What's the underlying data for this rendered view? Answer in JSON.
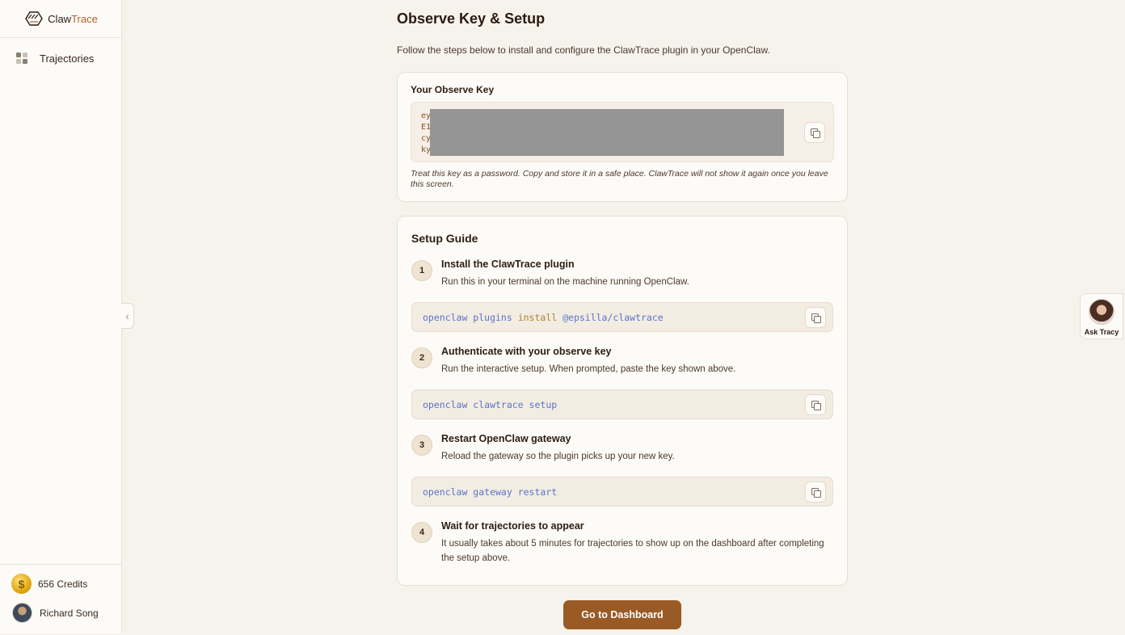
{
  "app": {
    "logo_text_1": "Claw",
    "logo_text_2": "Trace"
  },
  "sidebar": {
    "items": [
      {
        "label": "Trajectories",
        "icon": "grid-icon"
      }
    ],
    "credits_label": "656 Credits",
    "coin_symbol": "$",
    "user_name": "Richard Song",
    "collapse_glyph": "‹"
  },
  "page": {
    "title": "Observe Key & Setup",
    "subtitle": "Follow the steps below to install and configure the ClawTrace plugin in your OpenClaw."
  },
  "key_card": {
    "title": "Your Observe Key",
    "key_text": "ey                                                        tb\nE1                                                        DD\ncy                                                        GR\nky",
    "key_redacted": true,
    "warning": "Treat this key as a password. Copy and store it in a safe place. ClawTrace will not show it again once you leave this screen."
  },
  "guide": {
    "title": "Setup Guide",
    "steps": [
      {
        "num": "1",
        "title": "Install the ClawTrace plugin",
        "desc": "Run this in your terminal on the machine running OpenClaw.",
        "code_pre": "openclaw plugins ",
        "code_kw": "install",
        "code_post": " @epsilla/clawtrace"
      },
      {
        "num": "2",
        "title": "Authenticate with your observe key",
        "desc": "Run the interactive setup. When prompted, paste the key shown above.",
        "code": "openclaw clawtrace setup"
      },
      {
        "num": "3",
        "title": "Restart OpenClaw gateway",
        "desc": "Reload the gateway so the plugin picks up your new key.",
        "code": "openclaw gateway restart"
      },
      {
        "num": "4",
        "title": "Wait for trajectories to appear",
        "desc": "It usually takes about 5 minutes for trajectories to show up on the dashboard after completing the setup above."
      }
    ]
  },
  "cta_label": "Go to Dashboard",
  "assistant": {
    "label": "Ask Tracy"
  },
  "colors": {
    "accent": "#9a5a25",
    "code": "#5b74c8",
    "background": "#f6f2ec"
  }
}
